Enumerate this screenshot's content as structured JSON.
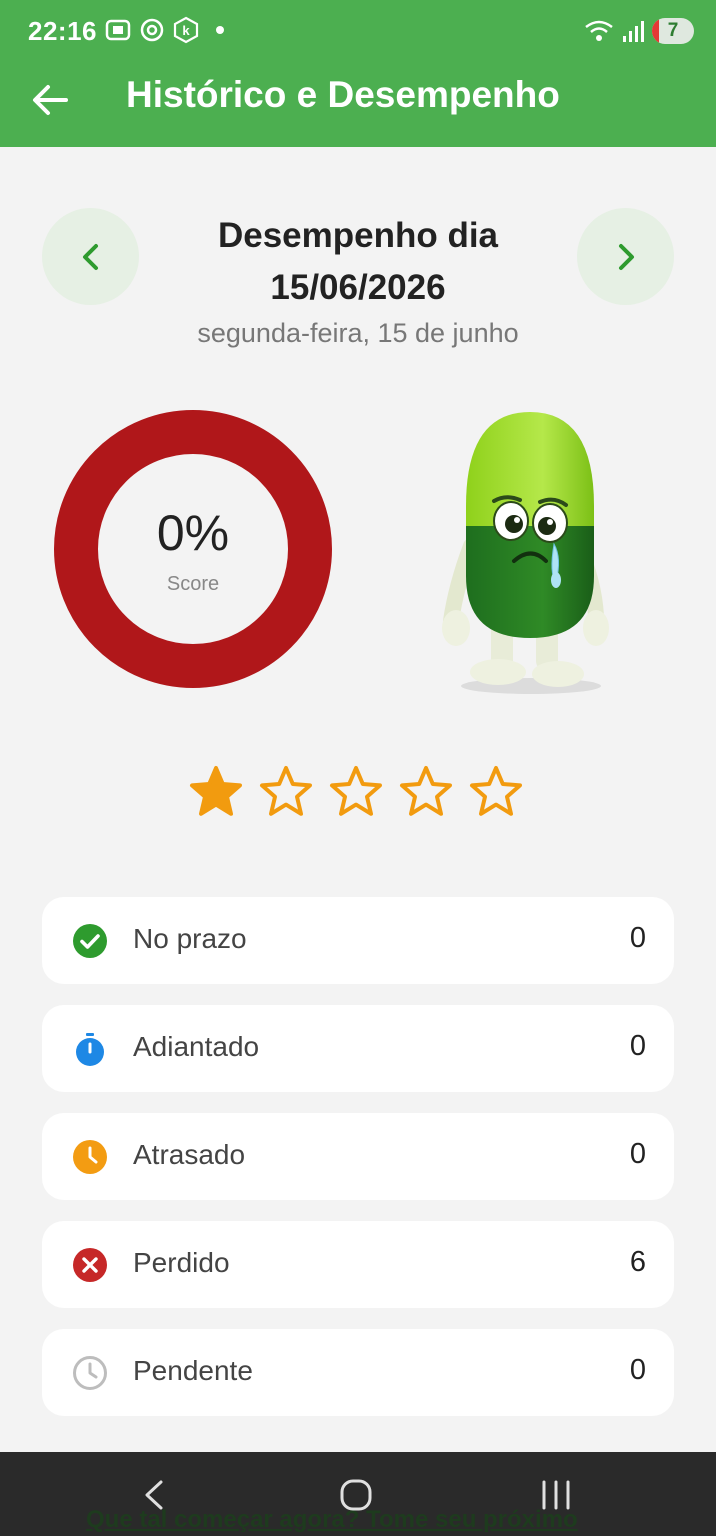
{
  "status_bar": {
    "time": "22:16",
    "battery": "7"
  },
  "app_bar": {
    "title": "Histórico e Desempenho"
  },
  "date_nav": {
    "title": "Desempenho dia 15/06/2026",
    "subtitle": "segunda-feira, 15 de junho"
  },
  "score": {
    "value": "0%",
    "label": "Score",
    "ring_color": "#b0171a"
  },
  "rating": {
    "filled_stars": 1,
    "total_stars": 5,
    "star_color": "#f29b0f"
  },
  "stats": [
    {
      "label": "No prazo",
      "value": "0",
      "icon": "check-circle-icon",
      "color": "#2e9b2e"
    },
    {
      "label": "Adiantado",
      "value": "0",
      "icon": "stopwatch-icon",
      "color": "#1e88e5"
    },
    {
      "label": "Atrasado",
      "value": "0",
      "icon": "clock-icon",
      "color": "#f39c12"
    },
    {
      "label": "Perdido",
      "value": "6",
      "icon": "x-circle-icon",
      "color": "#c62828"
    },
    {
      "label": "Pendente",
      "value": "0",
      "icon": "clock-outline-icon",
      "color": "#bdbdbd"
    }
  ],
  "footer_hidden_text": "Que tal começar agora? Tome seu próximo",
  "colors": {
    "primary": "#4caf50",
    "background": "#f3f3f3"
  }
}
